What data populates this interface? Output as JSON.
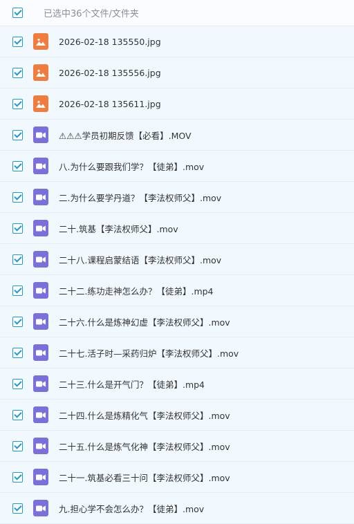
{
  "header": {
    "selection_text": "已选中36个文件/文件夹"
  },
  "files": [
    {
      "name": "2026-02-18 135550.jpg",
      "type": "image"
    },
    {
      "name": "2026-02-18 135556.jpg",
      "type": "image"
    },
    {
      "name": "2026-02-18 135611.jpg",
      "type": "image"
    },
    {
      "name": "⚠⚠⚠学员初期反馈【必看】.MOV",
      "type": "video"
    },
    {
      "name": "八.为什么要跟我们学？【徒弟】.mov",
      "type": "video"
    },
    {
      "name": "二.为什么要学丹道？【李法权师父】.mov",
      "type": "video"
    },
    {
      "name": "二十.筑基【李法权师父】.mov",
      "type": "video"
    },
    {
      "name": "二十八.课程启蒙结语【李法权师父】.mov",
      "type": "video"
    },
    {
      "name": "二十二.练功走神怎么办？【徒弟】.mp4",
      "type": "video"
    },
    {
      "name": "二十六.什么是炼神幻虚【李法权师父】.mov",
      "type": "video"
    },
    {
      "name": "二十七.活子时—采药归炉【李法权师父】.mov",
      "type": "video"
    },
    {
      "name": "二十三.什么是开气门？【徒弟】.mp4",
      "type": "video"
    },
    {
      "name": "二十四.什么是炼精化气【李法权师父】.mov",
      "type": "video"
    },
    {
      "name": "二十五.什么是炼气化神【李法权师父】.mov",
      "type": "video"
    },
    {
      "name": "二十一.筑基必看三十问【李法权师父】.mov",
      "type": "video"
    },
    {
      "name": "九.担心学不会怎么办？【徒弟】.mov",
      "type": "video"
    }
  ],
  "colors": {
    "accent": "#1a9bd7",
    "image_icon": "#f07c3e",
    "video_icon": "#7b6fdc",
    "row_bg": "#f2f9fe"
  }
}
